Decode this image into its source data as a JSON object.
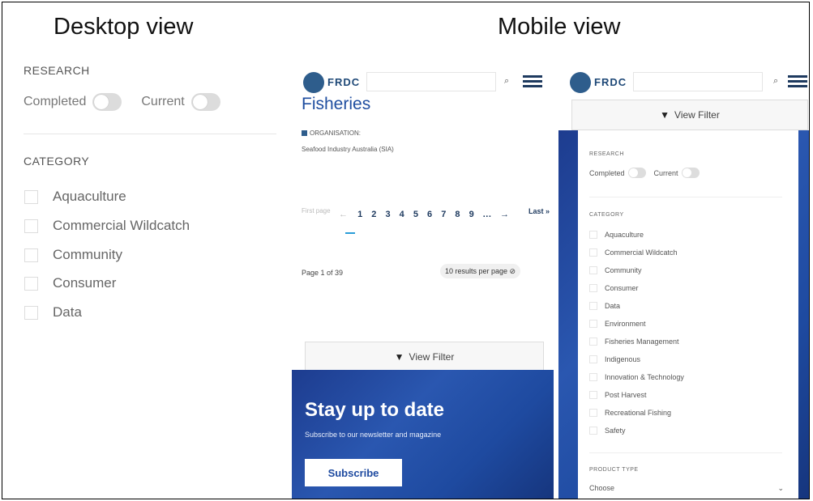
{
  "headings": {
    "desktop": "Desktop view",
    "mobile": "Mobile view"
  },
  "desktop": {
    "research_label": "RESEARCH",
    "completed_label": "Completed",
    "current_label": "Current",
    "category_label": "CATEGORY",
    "categories": [
      "Aquaculture",
      "Commercial Wildcatch",
      "Community",
      "Consumer",
      "Data"
    ]
  },
  "mobile1": {
    "logo": "FRDC",
    "search_icon": "⌕",
    "title": "Fisheries",
    "org_label": "ORGANISATION:",
    "org_value": "Seafood Industry Australia (SIA)",
    "pager": {
      "first": "First page",
      "prev": "←",
      "pages": [
        "1",
        "2",
        "3",
        "4",
        "5",
        "6",
        "7",
        "8",
        "9",
        "...",
        "→"
      ],
      "last": "Last »"
    },
    "page_info": "Page 1 of 39",
    "per_page": "10 results per page ⊘",
    "view_filter": "View Filter",
    "newsletter_title": "Stay up to date",
    "newsletter_sub": "Subscribe to our newsletter and magazine",
    "subscribe": "Subscribe"
  },
  "mobile2": {
    "logo": "FRDC",
    "view_filter": "View Filter",
    "research_label": "RESEARCH",
    "completed_label": "Completed",
    "current_label": "Current",
    "category_label": "CATEGORY",
    "categories": [
      "Aquaculture",
      "Commercial Wildcatch",
      "Community",
      "Consumer",
      "Data",
      "Environment",
      "Fisheries Management",
      "Indigenous",
      "Innovation & Technology",
      "Post Harvest",
      "Recreational Fishing",
      "Safety"
    ],
    "product_type_label": "PRODUCT TYPE",
    "product_type_value": "Choose"
  },
  "colors": {
    "brand_blue": "#1e4aa0",
    "logo_blue": "#2e5d8c"
  }
}
